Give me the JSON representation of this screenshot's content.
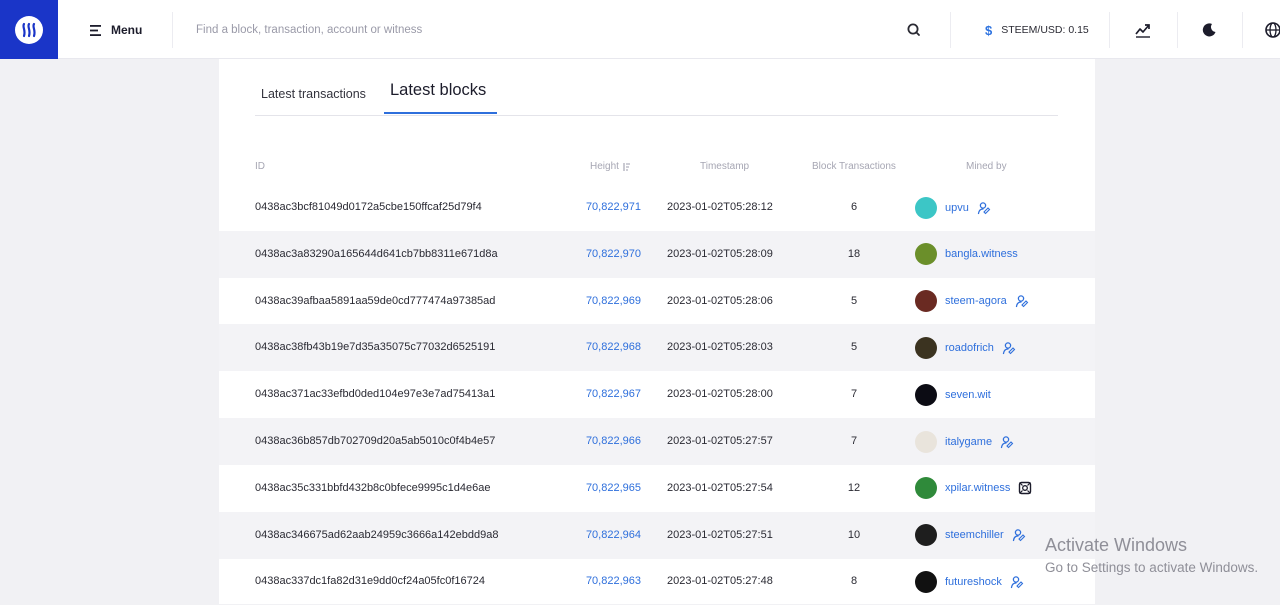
{
  "header": {
    "menu_label": "Menu",
    "search_placeholder": "Find a block, transaction, account or witness",
    "price_label": "STEEM/USD: 0.15",
    "price_currency_symbol": "$",
    "icons": [
      "steem-logo-icon",
      "menu-icon",
      "search-icon",
      "chart-icon",
      "moon-icon",
      "globe-icon"
    ]
  },
  "tabs": [
    {
      "label": "Latest transactions",
      "active": false
    },
    {
      "label": "Latest blocks",
      "active": true
    }
  ],
  "table": {
    "columns": {
      "id": "ID",
      "height": "Height",
      "timestamp": "Timestamp",
      "block_transactions": "Block Transactions",
      "mined_by": "Mined by"
    },
    "rows": [
      {
        "id": "0438ac3bcf81049d0172a5cbe150ffcaf25d79f4",
        "height": "70,822,971",
        "timestamp": "2023-01-02T05:28:12",
        "txs": "6",
        "miner": "upvu",
        "avatar_color": "#3cc6c6",
        "badge": "person"
      },
      {
        "id": "0438ac3a83290a165644d641cb7bb8311e671d8a",
        "height": "70,822,970",
        "timestamp": "2023-01-02T05:28:09",
        "txs": "18",
        "miner": "bangla.witness",
        "avatar_color": "#6b8f2a",
        "badge": ""
      },
      {
        "id": "0438ac39afbaa5891aa59de0cd777474a97385ad",
        "height": "70,822,969",
        "timestamp": "2023-01-02T05:28:06",
        "txs": "5",
        "miner": "steem-agora",
        "avatar_color": "#6a2a22",
        "badge": "person"
      },
      {
        "id": "0438ac38fb43b19e7d35a35075c77032d6525191",
        "height": "70,822,968",
        "timestamp": "2023-01-02T05:28:03",
        "txs": "5",
        "miner": "roadofrich",
        "avatar_color": "#3b3320",
        "badge": "person"
      },
      {
        "id": "0438ac371ac33efbd0ded104e97e3e7ad75413a1",
        "height": "70,822,967",
        "timestamp": "2023-01-02T05:28:00",
        "txs": "7",
        "miner": "seven.wit",
        "avatar_color": "#0c0c14",
        "badge": ""
      },
      {
        "id": "0438ac36b857db702709d20a5ab5010c0f4b4e57",
        "height": "70,822,966",
        "timestamp": "2023-01-02T05:27:57",
        "txs": "7",
        "miner": "italygame",
        "avatar_color": "#e9e4dc",
        "badge": "person"
      },
      {
        "id": "0438ac35c331bbfd432b8c0bfece9995c1d4e6ae",
        "height": "70,822,965",
        "timestamp": "2023-01-02T05:27:54",
        "txs": "12",
        "miner": "xpilar.witness",
        "avatar_color": "#2f8a3a",
        "badge": "gear"
      },
      {
        "id": "0438ac346675ad62aab24959c3666a142ebdd9a8",
        "height": "70,822,964",
        "timestamp": "2023-01-02T05:27:51",
        "txs": "10",
        "miner": "steemchiller",
        "avatar_color": "#1e1e1e",
        "badge": "person"
      },
      {
        "id": "0438ac337dc1fa82d31e9dd0cf24a05fc0f16724",
        "height": "70,822,963",
        "timestamp": "2023-01-02T05:27:48",
        "txs": "8",
        "miner": "futureshock",
        "avatar_color": "#111111",
        "badge": "person"
      }
    ]
  },
  "watermark": {
    "line1": "Activate Windows",
    "line2": "Go to Settings to activate Windows."
  }
}
